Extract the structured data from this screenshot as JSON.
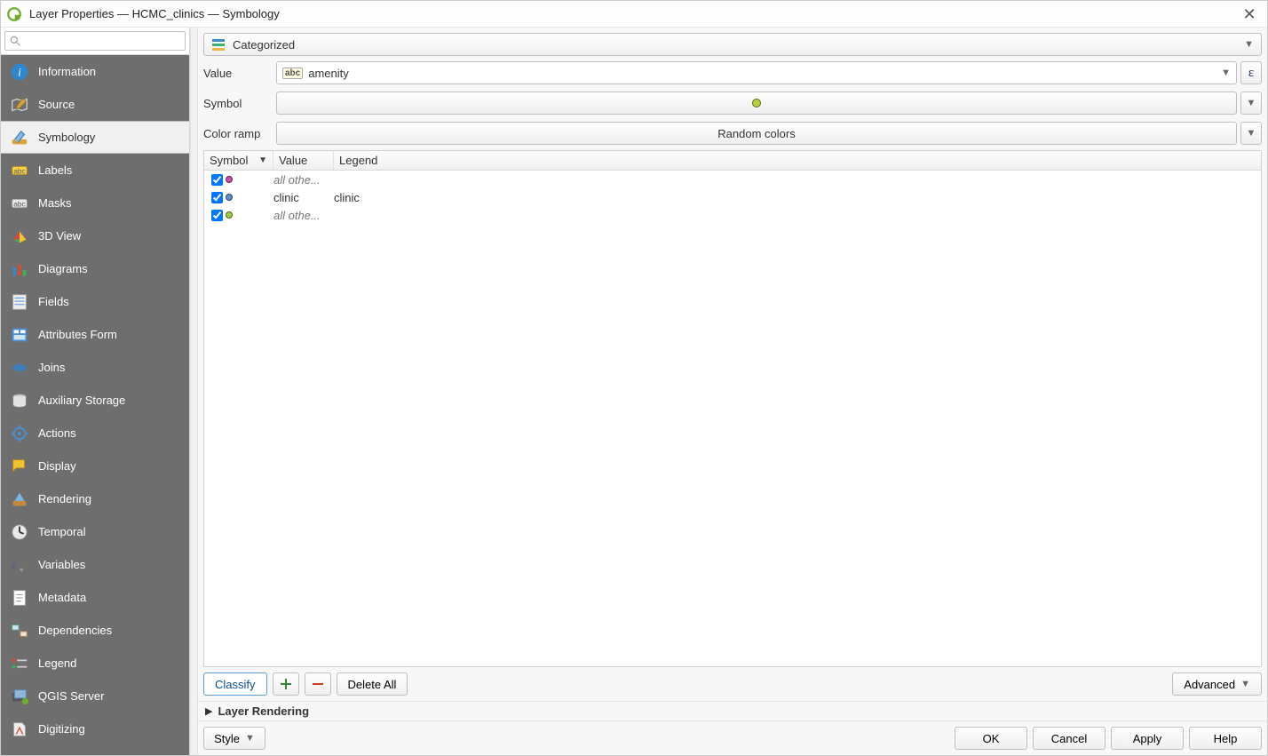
{
  "title": "Layer Properties — HCMC_clinics — Symbology",
  "search_placeholder": "",
  "renderer_type": "Categorized",
  "value_label": "Value",
  "value_field": "amenity",
  "symbol_label": "Symbol",
  "color_ramp_label": "Color ramp",
  "color_ramp_text": "Random colors",
  "columns": {
    "symbol": "Symbol",
    "value": "Value",
    "legend": "Legend"
  },
  "rows": [
    {
      "checked": true,
      "color": "#c84fa3",
      "value": "all othe...",
      "legend": "",
      "italic": true
    },
    {
      "checked": true,
      "color": "#5d8fc8",
      "value": "clinic",
      "legend": "clinic",
      "italic": false
    },
    {
      "checked": true,
      "color": "#9ccb3b",
      "value": "all othe...",
      "legend": "",
      "italic": true
    }
  ],
  "classify": "Classify",
  "delete_all": "Delete All",
  "advanced": "Advanced",
  "layer_rendering": "Layer Rendering",
  "style": "Style",
  "ok": "OK",
  "cancel": "Cancel",
  "apply": "Apply",
  "help": "Help",
  "sidebar": [
    "Information",
    "Source",
    "Symbology",
    "Labels",
    "Masks",
    "3D View",
    "Diagrams",
    "Fields",
    "Attributes Form",
    "Joins",
    "Auxiliary Storage",
    "Actions",
    "Display",
    "Rendering",
    "Temporal",
    "Variables",
    "Metadata",
    "Dependencies",
    "Legend",
    "QGIS Server",
    "Digitizing"
  ],
  "active_index": 2
}
